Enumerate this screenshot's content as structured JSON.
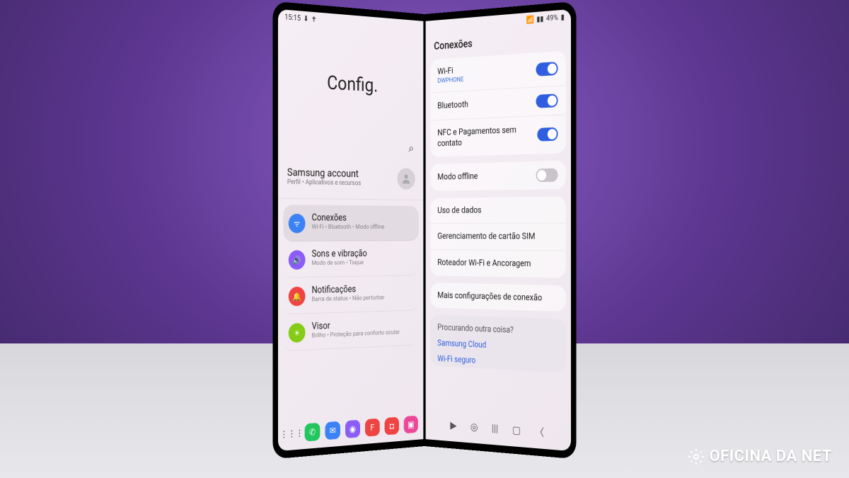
{
  "watermark": "OFICINA DA NET",
  "status": {
    "time": "15:15",
    "battery": "49%"
  },
  "left": {
    "title": "Config.",
    "account": {
      "title": "Samsung account",
      "sub": "Perfil • Aplicativos e recursos"
    },
    "items": [
      {
        "title": "Conexões",
        "sub": "Wi-Fi • Bluetooth • Modo offline",
        "icon": "wifi",
        "color": "ic-blue",
        "selected": true
      },
      {
        "title": "Sons e vibração",
        "sub": "Modo de som • Toque",
        "icon": "sound",
        "color": "ic-purple",
        "selected": false
      },
      {
        "title": "Notificações",
        "sub": "Barra de status • Não perturbar",
        "icon": "bell",
        "color": "ic-red",
        "selected": false
      },
      {
        "title": "Visor",
        "sub": "Brilho • Proteção para conforto ocular",
        "icon": "display",
        "color": "ic-green",
        "selected": false
      }
    ]
  },
  "right": {
    "title": "Conexões",
    "toggles": [
      {
        "label": "Wi-Fi",
        "sub": "DWPHONE",
        "on": true
      },
      {
        "label": "Bluetooth",
        "sub": "",
        "on": true
      },
      {
        "label": "NFC e Pagamentos sem contato",
        "sub": "",
        "on": true
      }
    ],
    "offline": {
      "label": "Modo offline",
      "on": false
    },
    "links": [
      "Uso de dados",
      "Gerenciamento de cartão SIM",
      "Roteador Wi-Fi e Ancoragem"
    ],
    "more": "Mais configurações de conexão",
    "suggest": {
      "title": "Procurando outra coisa?",
      "links": [
        "Samsung Cloud",
        "Wi-Fi seguro"
      ]
    }
  }
}
